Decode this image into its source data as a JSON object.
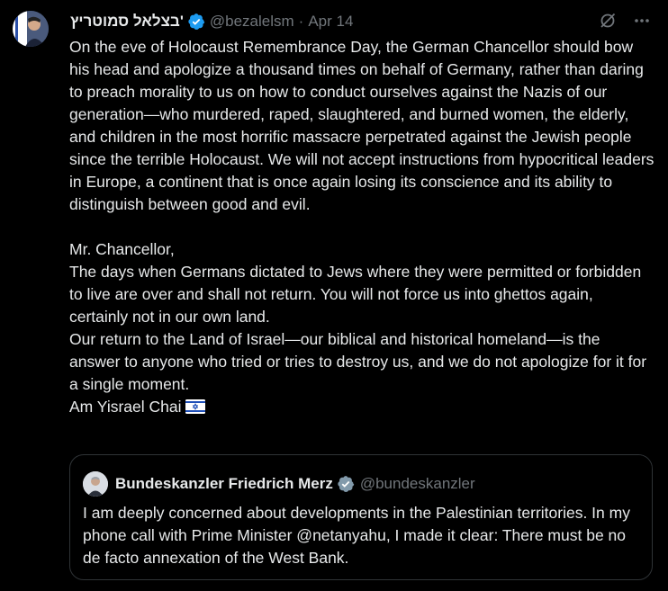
{
  "tweet": {
    "author": {
      "display_name": "בצלאל סמוטריץ'",
      "handle": "@bezalelsm",
      "separator": "·",
      "date": "Apr 14",
      "verified_icon": "verified-badge-icon"
    },
    "actions": {
      "grok_icon": "grok-slash-icon",
      "more_icon": "more-horizontal-icon"
    },
    "body": {
      "paragraph_1": "On the eve of Holocaust Remembrance Day, the German Chancellor should bow his head and apologize a thousand times on behalf of Germany, rather than daring to preach morality to us on how to conduct ourselves against the Nazis of our generation—who murdered, raped, slaughtered, and burned women, the elderly, and children in the most horrific massacre perpetrated against the Jewish people since the terrible Holocaust. We will not accept instructions from hypocritical leaders in Europe, a continent that is once again losing its conscience and its ability to distinguish between good and evil.",
      "salutation": "Mr. Chancellor,",
      "paragraph_2": "The days when Germans dictated to Jews where they were permitted or forbidden to live are over and shall not return. You will not force us into ghettos again, certainly not in our own land.",
      "paragraph_3": "Our return to the Land of Israel—our biblical and historical homeland—is the answer to anyone who tried or tries to destroy us, and we do not apologize for it for a single moment.",
      "closing": "Am Yisrael Chai",
      "closing_icon": "israel-flag-icon"
    },
    "quoted": {
      "display_name": "Bundeskanzler Friedrich Merz",
      "handle": "@bundeskanzler",
      "verified_icon": "verified-badge-gray-icon",
      "text": "I am deeply concerned about developments in the Palestinian territories. In my phone call with Prime Minister @netanyahu, I made it clear: There must be no de facto annexation of the West Bank."
    }
  },
  "colors": {
    "background": "#000000",
    "text_primary": "#e7e9ea",
    "text_secondary": "#71767b",
    "verified_blue": "#1d9bf0",
    "verified_gray": "#829aab",
    "border": "#2f3336"
  }
}
